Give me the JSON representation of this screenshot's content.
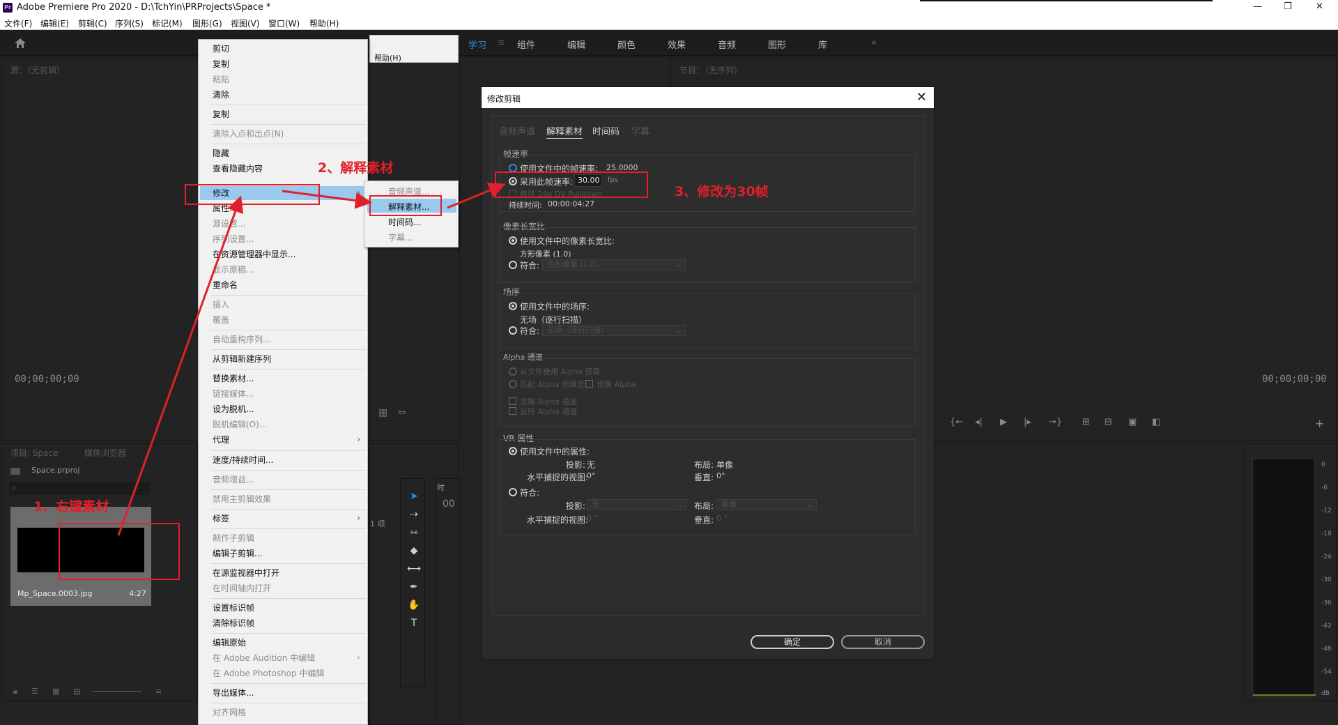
{
  "window": {
    "title": "Adobe Premiere Pro 2020 - D:\\TchYin\\PRProjects\\Space *",
    "app_icon": "Pr",
    "controls": [
      "—",
      "❐",
      "✕"
    ]
  },
  "menubar": [
    "文件(F)",
    "编辑(E)",
    "剪辑(C)",
    "序列(S)",
    "标记(M)",
    "图形(G)",
    "视图(V)",
    "窗口(W)",
    "帮助(H)"
  ],
  "workspaces": {
    "items": [
      "学习",
      "组件",
      "编辑",
      "颜色",
      "效果",
      "音频",
      "图形",
      "库"
    ],
    "active": "学习",
    "more": "»"
  },
  "source_monitor": {
    "title": "源：（无剪辑）",
    "timecode": "00;00;00;00"
  },
  "program_monitor": {
    "title": "节目：（无序列）",
    "timecode": "00;00;00;00"
  },
  "project_panel": {
    "tabs": [
      "项目: Space",
      "媒体浏览器"
    ],
    "file": "Space.prproj",
    "item_count": "1 项",
    "clip_name": "Mp_Space.0003.jpg",
    "clip_duration": "4:27"
  },
  "timeline_fragment": {
    "label": "时",
    "timecode": "00"
  },
  "context_menu": {
    "items": [
      {
        "label": "剪切",
        "disabled": false
      },
      {
        "label": "复制",
        "disabled": false
      },
      {
        "label": "粘贴",
        "disabled": true
      },
      {
        "label": "清除",
        "disabled": false
      },
      {
        "label": "复制",
        "disabled": false
      },
      {
        "label": "清除入点和出点(N)",
        "disabled": true
      },
      {
        "label": "隐藏",
        "disabled": false
      },
      {
        "label": "查看隐藏内容",
        "disabled": false
      },
      {
        "label": "修改",
        "disabled": false,
        "submenu": true,
        "highlighted": true
      },
      {
        "label": "属性...",
        "disabled": false
      },
      {
        "label": "源设置...",
        "disabled": true
      },
      {
        "label": "序列设置...",
        "disabled": true
      },
      {
        "label": "在资源管理器中显示...",
        "disabled": false
      },
      {
        "label": "显示原稿...",
        "disabled": true
      },
      {
        "label": "重命名",
        "disabled": false
      },
      {
        "label": "插入",
        "disabled": true
      },
      {
        "label": "覆盖",
        "disabled": true
      },
      {
        "label": "自动重构序列...",
        "disabled": true
      },
      {
        "label": "从剪辑新建序列",
        "disabled": false
      },
      {
        "label": "替换素材...",
        "disabled": false
      },
      {
        "label": "链接媒体...",
        "disabled": true
      },
      {
        "label": "设为脱机...",
        "disabled": false
      },
      {
        "label": "脱机编辑(O)...",
        "disabled": true
      },
      {
        "label": "代理",
        "disabled": false,
        "submenu": true
      },
      {
        "label": "速度/持续时间...",
        "disabled": false
      },
      {
        "label": "音频增益...",
        "disabled": true
      },
      {
        "label": "禁用主剪辑效果",
        "disabled": true
      },
      {
        "label": "标签",
        "disabled": false,
        "submenu": true
      },
      {
        "label": "制作子剪辑",
        "disabled": true
      },
      {
        "label": "编辑子剪辑...",
        "disabled": false
      },
      {
        "label": "在源监视器中打开",
        "disabled": false
      },
      {
        "label": "在时间轴内打开",
        "disabled": true
      },
      {
        "label": "设置标识帧",
        "disabled": false
      },
      {
        "label": "清除标识帧",
        "disabled": false
      },
      {
        "label": "编辑原始",
        "disabled": false
      },
      {
        "label": "在 Adobe Audition 中编辑",
        "disabled": true,
        "submenu": true
      },
      {
        "label": "在 Adobe Photoshop 中编辑",
        "disabled": true
      },
      {
        "label": "导出媒体...",
        "disabled": false
      },
      {
        "label": "对齐网格",
        "disabled": true
      }
    ]
  },
  "menu_fragment": {
    "label": "帮助(H)"
  },
  "submenu": {
    "items": [
      {
        "label": "音频声道...",
        "disabled": true
      },
      {
        "label": "解释素材...",
        "disabled": false,
        "highlighted": true
      },
      {
        "label": "时间码...",
        "disabled": false
      },
      {
        "label": "字幕...",
        "disabled": true
      }
    ]
  },
  "dialog": {
    "title": "修改剪辑",
    "close": "✕",
    "tabs": [
      {
        "label": "音频声道",
        "state": "disabled"
      },
      {
        "label": "解释素材",
        "state": "active"
      },
      {
        "label": "时间码",
        "state": "normal"
      },
      {
        "label": "字幕",
        "state": "disabled"
      }
    ],
    "frame_rate": {
      "title": "帧速率",
      "use_file_label": "使用文件中的帧速率:",
      "file_value": "25.0000",
      "assume_label": "采用此帧速率:",
      "assume_value": "30.00",
      "unit": "fps",
      "pulldown_label": "移除 24p DV Pulldown",
      "duration_label": "持续时间:",
      "duration_value": "00:00:04:27"
    },
    "pixel_aspect": {
      "title": "像素长宽比",
      "use_file_label": "使用文件中的像素长宽比:",
      "file_value": "方形像素 (1.0)",
      "conform_label": "符合:",
      "conform_value": "方形像素 (1.0)"
    },
    "field_order": {
      "title": "场序",
      "use_file_label": "使用文件中的场序:",
      "file_value": "无场（逐行扫描）",
      "conform_label": "符合:",
      "conform_value": "无场（逐行扫描）"
    },
    "alpha": {
      "title": "Alpha 通道",
      "from_file": "从文件使用 Alpha 预乘",
      "match": "匹配 Alpha 预乘至:",
      "premultiply": "预乘 Alpha",
      "ignore": "忽略 Alpha 通道",
      "invert": "反转 Alpha 通道"
    },
    "vr": {
      "title": "VR 属性",
      "use_file_label": "使用文件中的属性:",
      "projection_label": "投影:",
      "projection_value": "无",
      "layout_label": "布局:",
      "layout_value": "单像",
      "hfov_label": "水平捕捉的视图:",
      "hfov_value": "0°",
      "vfov_label": "垂直:",
      "vfov_value": "0°",
      "conform_label": "符合:",
      "c_projection_value": "无",
      "c_layout_value": "单像",
      "c_hfov_value": "0 °",
      "c_vfov_value": "0 °"
    },
    "ok": "确定",
    "cancel": "取消"
  },
  "annotations": {
    "step1": "1、右键素材",
    "step2": "2、解释素材",
    "step3": "3、修改为30帧",
    "color": "#e0202a"
  },
  "meter_ticks": [
    "0",
    "-6",
    "-12",
    "-18",
    "-24",
    "-30",
    "-36",
    "-42",
    "-48",
    "-54",
    "dB"
  ]
}
